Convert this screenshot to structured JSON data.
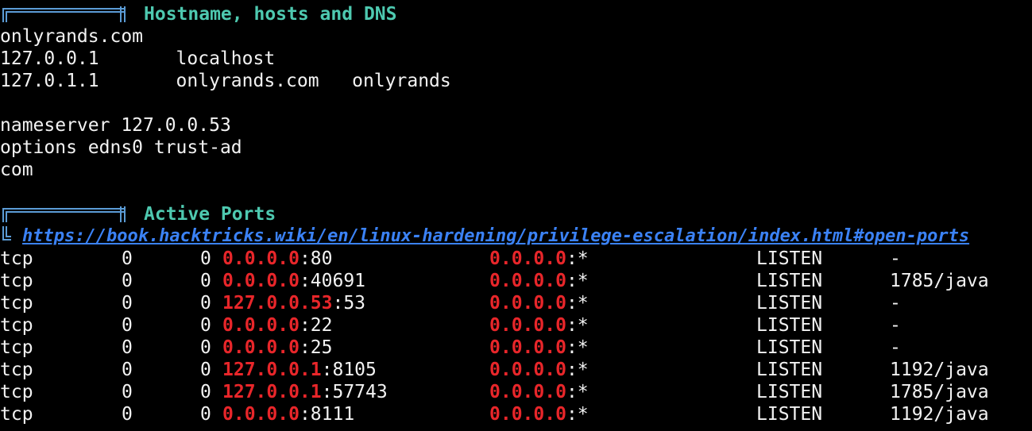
{
  "colors": {
    "background": "#000000",
    "text": "#f2f2f2",
    "section_title": "#4ec9b0",
    "deco_box": "#5b9bd5",
    "link": "#3b82f6",
    "ip_highlight": "#e8262a"
  },
  "sections": [
    {
      "title": "Hostname, hosts and DNS",
      "lines": [
        "onlyrands.com",
        "127.0.0.1       localhost",
        "127.0.1.1       onlyrands.com   onlyrands",
        "",
        "nameserver 127.0.0.53",
        "options edns0 trust-ad",
        "com",
        ""
      ]
    },
    {
      "title": "Active Ports",
      "link": "https://book.hacktricks.wiki/en/linux-hardening/privilege-escalation/index.html#open-ports"
    }
  ],
  "ports_table": {
    "rows": [
      {
        "proto": "tcp",
        "recvq": "0",
        "sendq": "0",
        "local_ip": "0.0.0.0",
        "local_port": ":80",
        "foreign_ip": "0.0.0.0",
        "foreign_port": ":*",
        "state": "LISTEN",
        "pid": "-"
      },
      {
        "proto": "tcp",
        "recvq": "0",
        "sendq": "0",
        "local_ip": "0.0.0.0",
        "local_port": ":40691",
        "foreign_ip": "0.0.0.0",
        "foreign_port": ":*",
        "state": "LISTEN",
        "pid": "1785/java"
      },
      {
        "proto": "tcp",
        "recvq": "0",
        "sendq": "0",
        "local_ip": "127.0.0.53",
        "local_port": ":53",
        "foreign_ip": "0.0.0.0",
        "foreign_port": ":*",
        "state": "LISTEN",
        "pid": "-"
      },
      {
        "proto": "tcp",
        "recvq": "0",
        "sendq": "0",
        "local_ip": "0.0.0.0",
        "local_port": ":22",
        "foreign_ip": "0.0.0.0",
        "foreign_port": ":*",
        "state": "LISTEN",
        "pid": "-"
      },
      {
        "proto": "tcp",
        "recvq": "0",
        "sendq": "0",
        "local_ip": "0.0.0.0",
        "local_port": ":25",
        "foreign_ip": "0.0.0.0",
        "foreign_port": ":*",
        "state": "LISTEN",
        "pid": "-"
      },
      {
        "proto": "tcp",
        "recvq": "0",
        "sendq": "0",
        "local_ip": "127.0.0.1",
        "local_port": ":8105",
        "foreign_ip": "0.0.0.0",
        "foreign_port": ":*",
        "state": "LISTEN",
        "pid": "1192/java"
      },
      {
        "proto": "tcp",
        "recvq": "0",
        "sendq": "0",
        "local_ip": "127.0.0.1",
        "local_port": ":57743",
        "foreign_ip": "0.0.0.0",
        "foreign_port": ":*",
        "state": "LISTEN",
        "pid": "1785/java"
      },
      {
        "proto": "tcp",
        "recvq": "0",
        "sendq": "0",
        "local_ip": "0.0.0.0",
        "local_port": ":8111",
        "foreign_ip": "0.0.0.0",
        "foreign_port": ":*",
        "state": "LISTEN",
        "pid": "1192/java"
      }
    ]
  }
}
